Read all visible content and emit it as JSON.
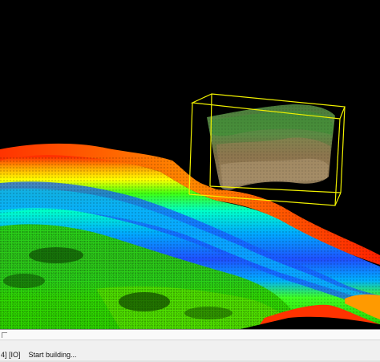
{
  "console": {
    "log_tag": "4] [IO]",
    "log_message": "Start building..."
  },
  "viewport": {
    "background": "#000000",
    "bounding_box_color": "#f2f200",
    "colormap": [
      "#ff2200",
      "#ffaa00",
      "#ffff00",
      "#33ff00",
      "#00ffd0",
      "#00b0ff",
      "#1a40ff"
    ]
  }
}
